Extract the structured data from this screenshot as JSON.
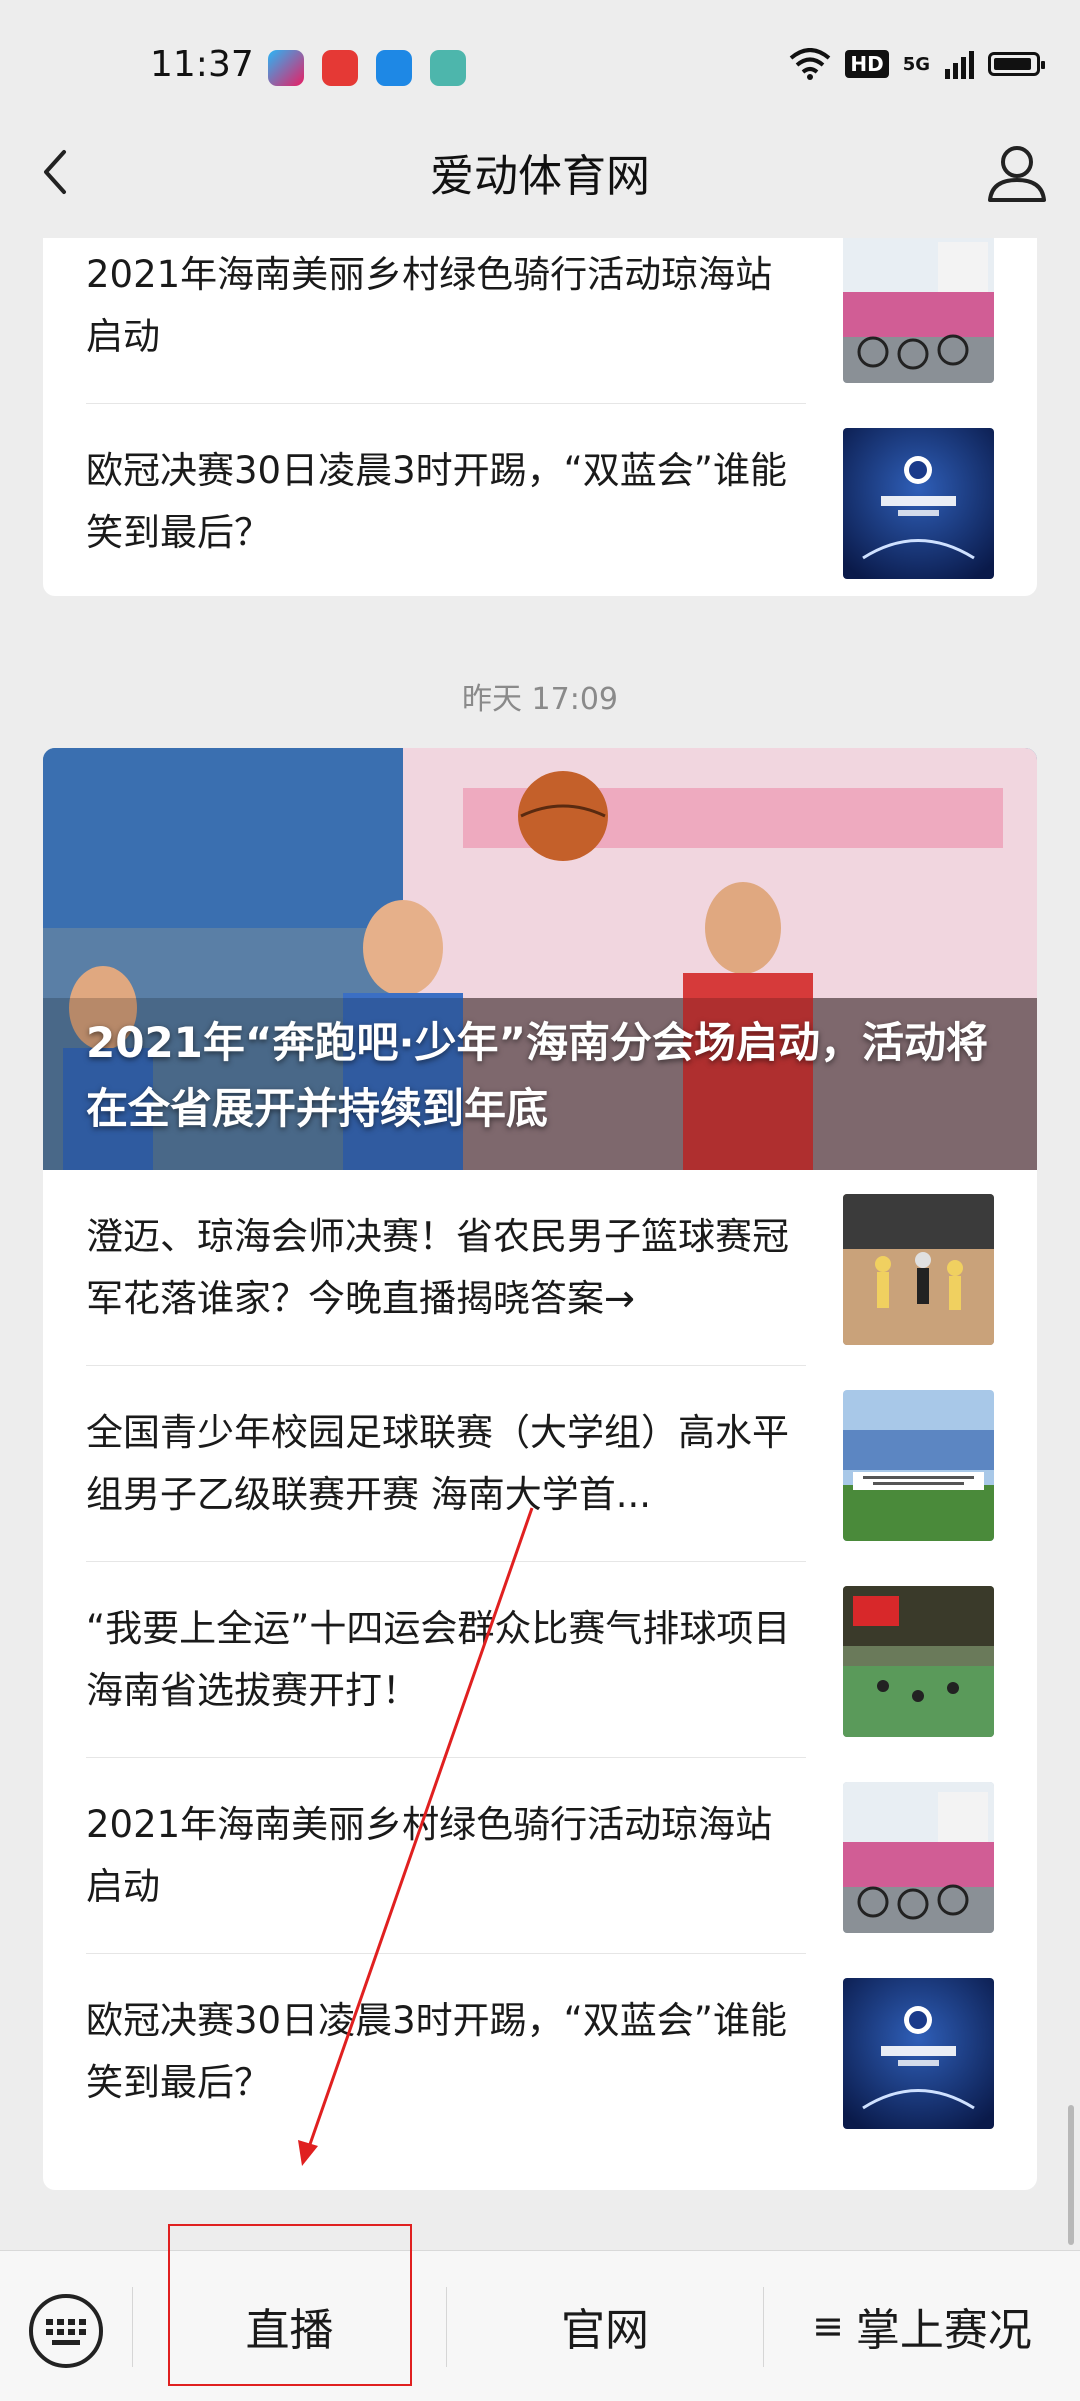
{
  "status_bar": {
    "time": "11:37",
    "hd": "HD",
    "network": "5G"
  },
  "nav": {
    "title": "爱动体育网"
  },
  "top_card": {
    "items": [
      {
        "title": "2021年海南美丽乡村绿色骑行活动琼海站启动",
        "thumb": "cycling"
      },
      {
        "title": "欧冠决赛30日凌晨3时开踢，“双蓝会”谁能笑到最后？",
        "thumb": "champions"
      }
    ]
  },
  "timestamp": "昨天 17:09",
  "main_card": {
    "hero_title": "2021年“奔跑吧·少年”海南分会场启动，活动将在全省展开并持续到年底",
    "items": [
      {
        "title": "澄迈、琼海会师决赛！省农民男子篮球赛冠军花落谁家？今晚直播揭晓答案→",
        "thumb": "basketball"
      },
      {
        "title": "全国青少年校园足球联赛（大学组）高水平组男子乙级联赛开赛 海南大学首...",
        "thumb": "football"
      },
      {
        "title": "“我要上全运”十四运会群众比赛气排球项目海南省选拔赛开打！",
        "thumb": "volleyball"
      },
      {
        "title": "2021年海南美丽乡村绿色骑行活动琼海站启动",
        "thumb": "cycling"
      },
      {
        "title": "欧冠决赛30日凌晨3时开踢，“双蓝会”谁能笑到最后？",
        "thumb": "champions"
      }
    ]
  },
  "bottom_menu": {
    "items": [
      {
        "label": "直播"
      },
      {
        "label": "官网"
      },
      {
        "label": "掌上赛况",
        "icon": "≡"
      }
    ]
  },
  "colors": {
    "background": "#ededed",
    "card": "#ffffff",
    "annotation": "#e02020"
  }
}
